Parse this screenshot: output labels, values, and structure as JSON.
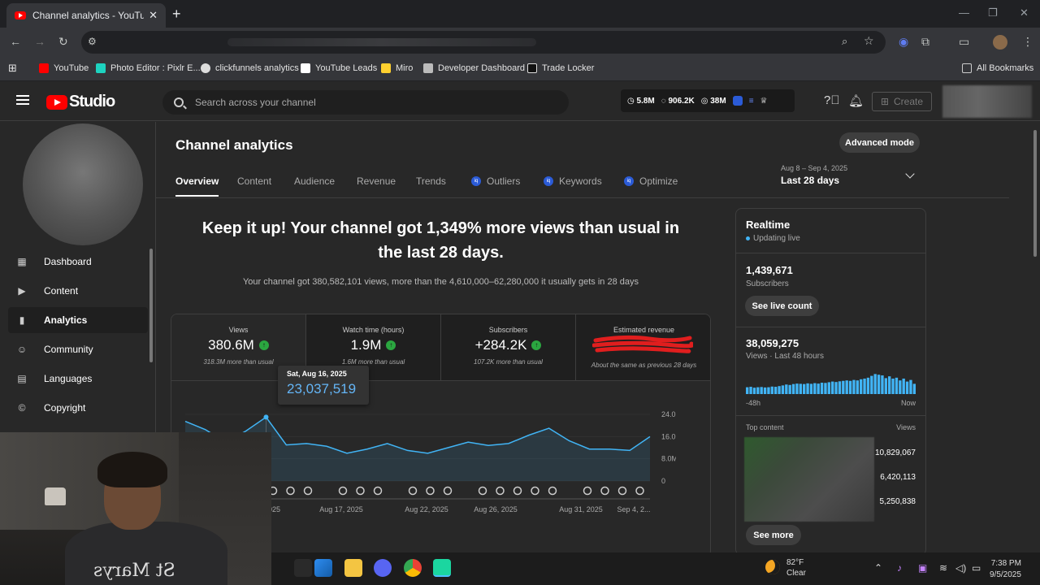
{
  "browser": {
    "tab_title": "Channel analytics - YouTube Studio",
    "bookmarks": [
      "YouTube",
      "Photo Editor : Pixlr E...",
      "clickfunnels analytics",
      "YouTube Leads",
      "Miro",
      "Developer Dashboard",
      "Trade Locker"
    ],
    "all_bookmarks": "All Bookmarks"
  },
  "studio": {
    "logo_text": "Studio",
    "search_placeholder": "Search across your channel",
    "ext_stats": {
      "watch": "5.8M",
      "subs": "906.2K",
      "views": "38M"
    },
    "create_label": "Create"
  },
  "sidebar": {
    "items": [
      {
        "label": "Dashboard",
        "icon": "dashboard-icon"
      },
      {
        "label": "Content",
        "icon": "content-icon"
      },
      {
        "label": "Analytics",
        "icon": "analytics-icon"
      },
      {
        "label": "Community",
        "icon": "community-icon"
      },
      {
        "label": "Languages",
        "icon": "languages-icon"
      },
      {
        "label": "Copyright",
        "icon": "copyright-icon"
      }
    ],
    "active": "Analytics"
  },
  "main": {
    "title": "Channel analytics",
    "advanced_mode": "Advanced mode",
    "tabs": [
      "Overview",
      "Content",
      "Audience",
      "Revenue",
      "Trends",
      "Outliers",
      "Keywords",
      "Optimize"
    ],
    "date_range": "Aug 8 – Sep 4, 2025",
    "date_label": "Last 28 days",
    "headline": "Keep it up! Your channel got 1,349% more views than usual in the last 28 days.",
    "subline": "Your channel got 380,582,101 views, more than the 4,610,000–62,280,000 it usually gets in 28 days",
    "metrics": [
      {
        "label": "Views",
        "value": "380.6M",
        "compare": "318.3M more than usual"
      },
      {
        "label": "Watch time (hours)",
        "value": "1.9M",
        "compare": "1.6M more than usual"
      },
      {
        "label": "Subscribers",
        "value": "+284.2K",
        "compare": "107.2K more than usual"
      },
      {
        "label": "Estimated revenue",
        "value": "",
        "compare": "About the same as previous 28 days"
      }
    ],
    "tooltip": {
      "date": "Sat, Aug 16, 2025",
      "value": "23,037,519"
    }
  },
  "chart_data": {
    "type": "area",
    "x": [
      "Aug 12",
      "Aug 13",
      "Aug 14",
      "Aug 15",
      "Aug 16",
      "Aug 17",
      "Aug 18",
      "Aug 19",
      "Aug 20",
      "Aug 21",
      "Aug 22",
      "Aug 23",
      "Aug 24",
      "Aug 25",
      "Aug 26",
      "Aug 27",
      "Aug 28",
      "Aug 29",
      "Aug 30",
      "Aug 31",
      "Sep 1",
      "Sep 2",
      "Sep 3",
      "Sep 4"
    ],
    "y": [
      21.5,
      18.5,
      14.0,
      18.0,
      23.0,
      13.0,
      13.5,
      12.5,
      10.0,
      11.5,
      13.5,
      11.0,
      10.0,
      12.0,
      14.0,
      12.8,
      13.5,
      16.5,
      19.0,
      14.5,
      11.5,
      11.5,
      11.0,
      16.0
    ],
    "yticks": [
      "24.0M",
      "16.0M",
      "8.0M",
      "0"
    ],
    "ylim": [
      0,
      24
    ],
    "xtick_labels": [
      "3, 2025",
      "Aug 17, 2025",
      "Aug 22, 2025",
      "Aug 26, 2025",
      "Aug 31, 2025",
      "Sep 4, 2..."
    ],
    "color": "#41b4f5"
  },
  "realtime": {
    "title": "Realtime",
    "status": "Updating live",
    "subscribers": "1,439,671",
    "subscribers_label": "Subscribers",
    "live_count_btn": "See live count",
    "views": "38,059,275",
    "views_label": "Views · Last 48 hours",
    "spark_start": "-48h",
    "spark_end": "Now",
    "top_content_label": "Top content",
    "views_col": "Views",
    "top_views": [
      "10,829,067",
      "6,420,113",
      "5,250,838"
    ],
    "see_more": "See more",
    "spark_values": [
      0.3,
      0.32,
      0.28,
      0.3,
      0.31,
      0.29,
      0.3,
      0.33,
      0.32,
      0.35,
      0.38,
      0.42,
      0.4,
      0.44,
      0.46,
      0.45,
      0.44,
      0.47,
      0.45,
      0.48,
      0.46,
      0.5,
      0.49,
      0.52,
      0.55,
      0.53,
      0.56,
      0.58,
      0.6,
      0.58,
      0.62,
      0.6,
      0.65,
      0.68,
      0.72,
      0.8,
      0.88,
      0.85,
      0.82,
      0.7,
      0.78,
      0.68,
      0.72,
      0.6,
      0.68,
      0.55,
      0.62,
      0.45
    ]
  },
  "taskbar": {
    "temp": "82°F",
    "weather": "Clear",
    "time": "7:38 PM",
    "date": "9/5/2025"
  },
  "webcam": {
    "shirt_text": "St Marys"
  }
}
